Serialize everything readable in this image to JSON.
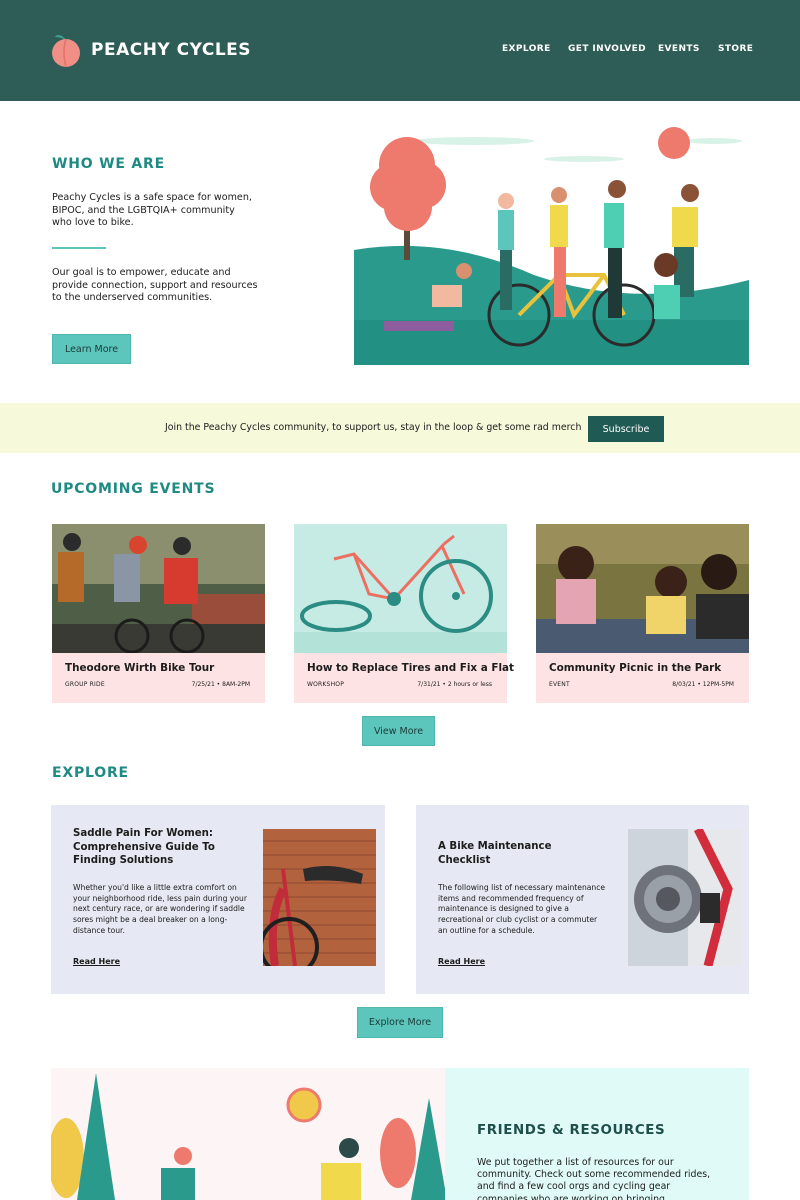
{
  "brand": {
    "name": "PEACHY CYCLES"
  },
  "nav": [
    "EXPLORE",
    "GET INVOLVED",
    "EVENTS",
    "STORE"
  ],
  "who": {
    "title": "WHO WE ARE",
    "intro": "Peachy Cycles is a safe space for women, BIPOC, and the LGBTQIA+ community who love to bike.",
    "goal": "Our goal is to empower, educate and provide connection, support and resources to the underserved communities.",
    "button": "Learn More"
  },
  "banner": {
    "text": "Join the Peachy Cycles community, to support us, stay in the loop & get some rad merch",
    "button": "Subscribe"
  },
  "events": {
    "title": "UPCOMING EVENTS",
    "items": [
      {
        "title": "Theodore Wirth Bike Tour",
        "type": "GROUP RIDE",
        "date": "7/25/21 • 8AM-2PM"
      },
      {
        "title": "How to Replace Tires and Fix a Flat",
        "type": "WORKSHOP",
        "date": "7/31/21 • 2 hours or less"
      },
      {
        "title": "Community Picnic in the Park",
        "type": "EVENT",
        "date": "8/03/21 • 12PM-5PM"
      }
    ],
    "button": "View More"
  },
  "explore": {
    "title": "EXPLORE",
    "items": [
      {
        "title": "Saddle Pain For Women: Comprehensive Guide To Finding Solutions",
        "desc": "Whether you'd like a little extra comfort on your neighborhood ride, less pain during your next century race, or are wondering if saddle sores might be a deal breaker on a long-distance tour.",
        "link": "Read Here"
      },
      {
        "title": "A Bike Maintenance Checklist",
        "desc": "The following list of necessary maintenance items and recommended frequency of maintenance is designed to give a recreational or club cyclist or a commuter an outline for a schedule.",
        "link": "Read Here"
      }
    ],
    "button": "Explore More"
  },
  "friends": {
    "title": "FRIENDS & RESOURCES",
    "text": "We put together a list of resources for our community. Check out some recommended rides, and find a few cool orgs and cycling gear companies who are working on bringing"
  }
}
